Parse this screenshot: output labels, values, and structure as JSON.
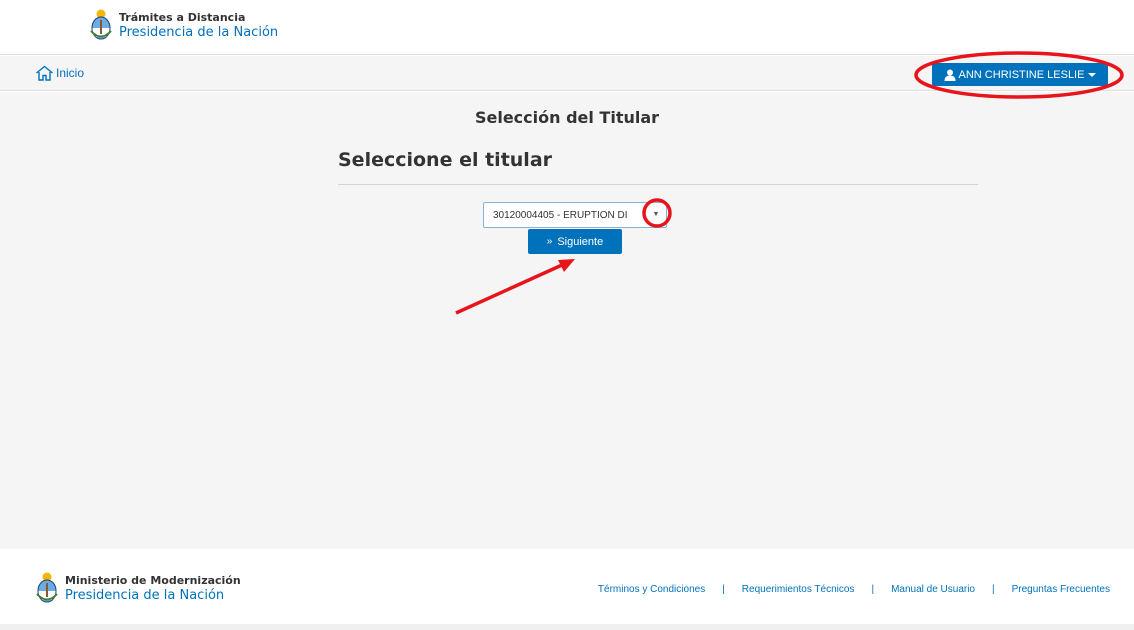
{
  "header": {
    "brand_line1": "Trámites a Distancia",
    "brand_line2": "Presidencia de la Nación",
    "seal_icon": "argentina-coat-of-arms-icon"
  },
  "navbar": {
    "home_label": "Inicio",
    "home_icon": "home-icon",
    "user_name": "ANN CHRISTINE LESLIE",
    "user_icon": "user-icon"
  },
  "main": {
    "page_title": "Selección del Titular",
    "section_title": "Seleccione el titular",
    "titular_select": {
      "selected_value": "30120004405 - ERUPTION DI"
    },
    "next_button_label": "Siguiente",
    "next_button_icon": "double-chevron-right-icon"
  },
  "footer": {
    "brand_line1": "Ministerio de Modernización",
    "brand_line2": "Presidencia de la Nación",
    "links": [
      "Términos y Condiciones",
      "Requerimientos Técnicos",
      "Manual de Usuario",
      "Preguntas Frecuentes"
    ],
    "separator": "|"
  },
  "annotations": {
    "color": "#e8141c",
    "marks": [
      "ellipse-around-user-menu",
      "circle-around-select-arrow",
      "arrow-pointing-to-next-button"
    ]
  },
  "colors": {
    "brand_blue": "#0072bb",
    "page_background": "#f5f5f5",
    "annotation_red": "#e8141c"
  }
}
